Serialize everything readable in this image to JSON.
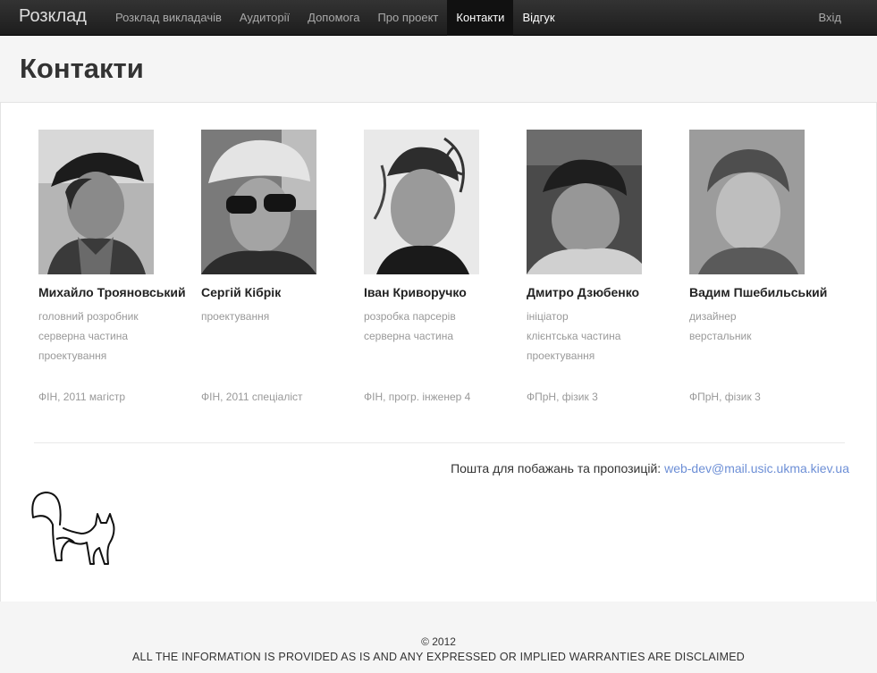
{
  "navbar": {
    "brand": "Розклад",
    "items": [
      {
        "label": "Розклад викладачів"
      },
      {
        "label": "Аудиторії"
      },
      {
        "label": "Допомога"
      },
      {
        "label": "Про проект"
      },
      {
        "label": "Контакти",
        "active": true
      },
      {
        "label": "Відгук"
      }
    ],
    "login": "Вхід"
  },
  "page": {
    "title": "Контакти"
  },
  "people": [
    {
      "name": "Михайло Трояновський",
      "roles": [
        "головний розробник",
        "серверна частина",
        "проектування"
      ],
      "edu": "ФІН, 2011 магістр"
    },
    {
      "name": "Сергій Кібрік",
      "roles": [
        "проектування"
      ],
      "edu": "ФІН, 2011 спеціаліст"
    },
    {
      "name": "Іван Криворучко",
      "roles": [
        "розробка парсерів",
        "серверна частина"
      ],
      "edu": "ФІН, прогр. інженер 4"
    },
    {
      "name": "Дмитро Дзюбенко",
      "roles": [
        "ініціатор",
        "клієнтська частина",
        "проектування"
      ],
      "edu": "ФПрН, фізик 3"
    },
    {
      "name": "Вадим Пшебильський",
      "roles": [
        "дизайнер",
        "верстальник"
      ],
      "edu": "ФПрН, фізик 3"
    }
  ],
  "contact": {
    "text": "Пошта для побажань та пропозицій:",
    "email": "web-dev@mail.usic.ukma.kiev.ua"
  },
  "footer": {
    "copyright": "© 2012",
    "disclaimer": "ALL THE INFORMATION IS PROVIDED AS IS AND ANY EXPRESSED OR IMPLIED WARRANTIES ARE DISCLAIMED"
  }
}
